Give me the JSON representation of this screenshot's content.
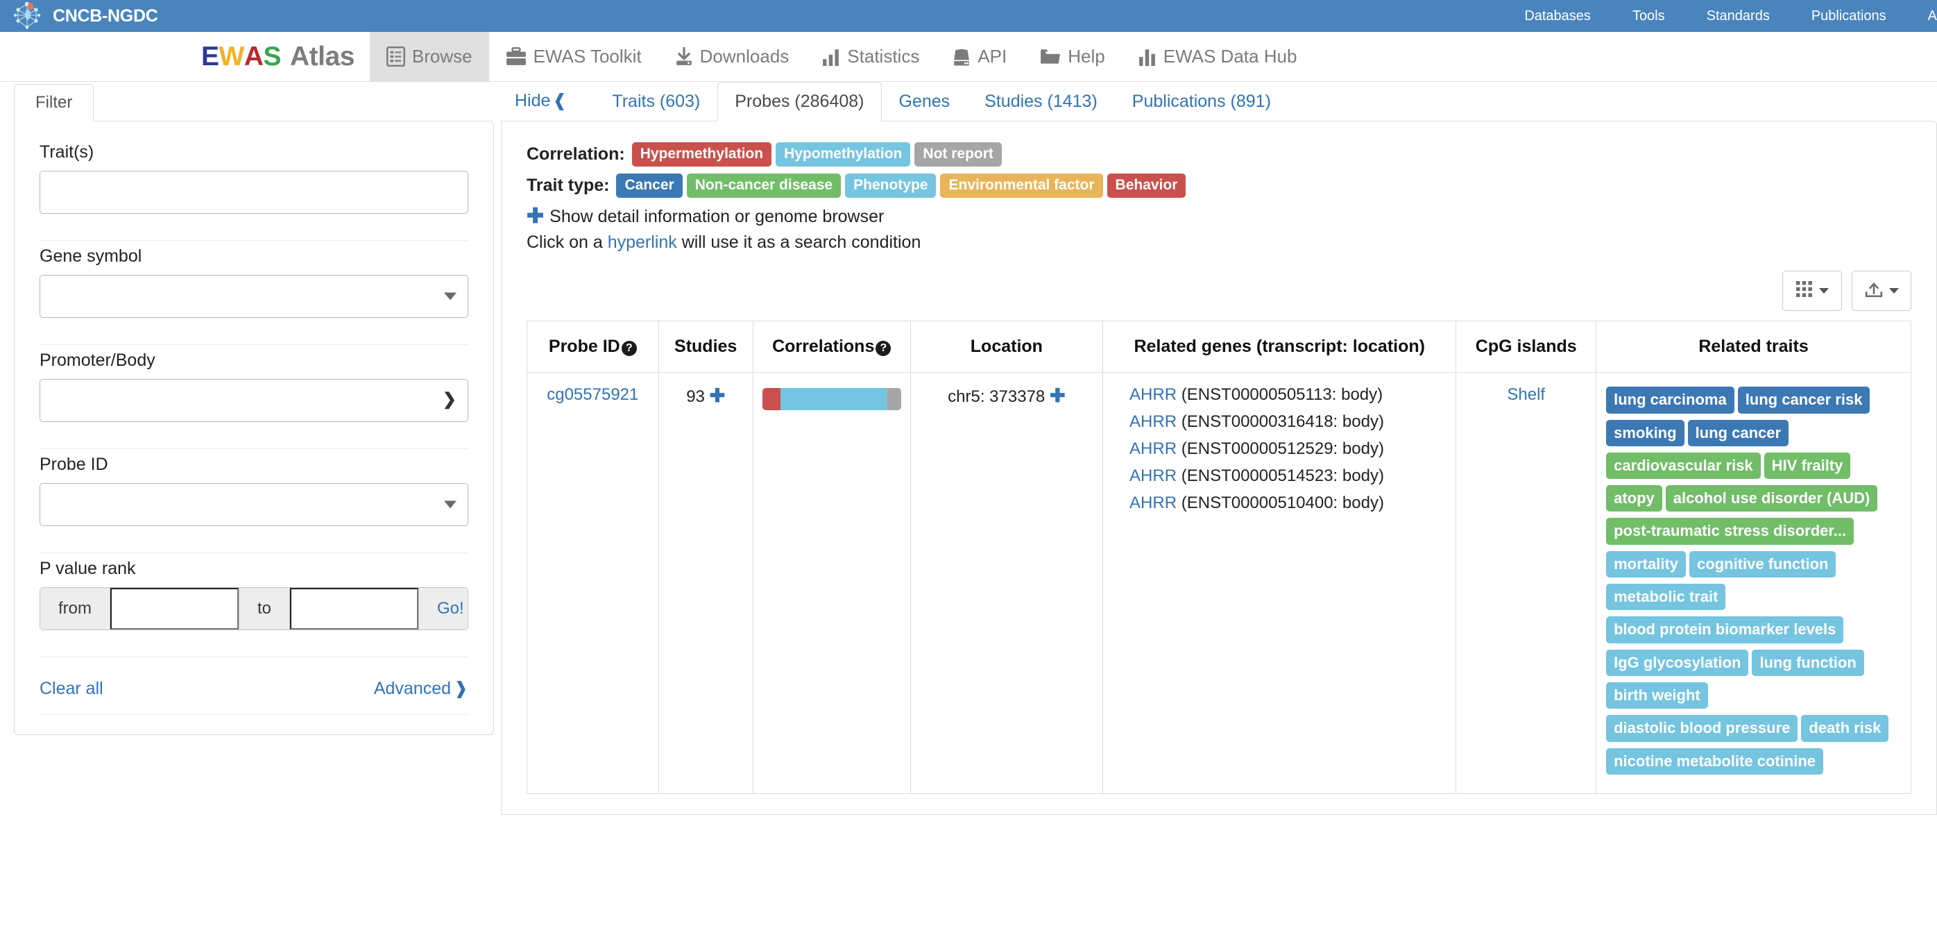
{
  "topbar": {
    "brand": "CNCB-NGDC",
    "logo_icon": "network-molecule-icon",
    "nav": [
      {
        "label": "Databases"
      },
      {
        "label": "Tools"
      },
      {
        "label": "Standards"
      },
      {
        "label": "Publications"
      },
      {
        "label": "A"
      }
    ],
    "bg_color": "#4a84bd"
  },
  "appbar": {
    "logo": {
      "e": "E",
      "w": "W",
      "a": "A",
      "s": "S",
      "atlas": "Atlas",
      "colors": {
        "e": "#2b3a97",
        "w": "#f2b227",
        "a": "#b92a2c",
        "s": "#3aa64c",
        "atlas": "#7d7d7d"
      }
    },
    "items": [
      {
        "label": "Browse",
        "icon": "list-document-icon",
        "active": true
      },
      {
        "label": "EWAS Toolkit",
        "icon": "briefcase-icon",
        "active": false
      },
      {
        "label": "Downloads",
        "icon": "download-icon",
        "active": false
      },
      {
        "label": "Statistics",
        "icon": "bar-chart-icon",
        "active": false
      },
      {
        "label": "API",
        "icon": "server-icon",
        "active": false
      },
      {
        "label": "Help",
        "icon": "folder-icon",
        "active": false
      },
      {
        "label": "EWAS Data Hub",
        "icon": "bar-chart-icon",
        "active": false
      }
    ]
  },
  "sidebar": {
    "tab_label": "Filter",
    "fields": {
      "traits_label": "Trait(s)",
      "traits_value": "",
      "gene_symbol_label": "Gene symbol",
      "gene_symbol_value": "",
      "promoter_body_label": "Promoter/Body",
      "promoter_body_value": "",
      "probe_id_label": "Probe ID",
      "probe_id_value": "",
      "p_value_rank_label": "P value rank",
      "from_label": "from",
      "from_value": "",
      "to_label": "to",
      "to_value": "",
      "go_label": "Go!"
    },
    "clear_all": "Clear all",
    "advanced": "Advanced"
  },
  "tabs": {
    "hide_label": "Hide",
    "items": [
      {
        "label": "Traits (603)",
        "active": false
      },
      {
        "label": "Probes (286408)",
        "active": true
      },
      {
        "label": "Genes",
        "active": false
      },
      {
        "label": "Studies (1413)",
        "active": false
      },
      {
        "label": "Publications (891)",
        "active": false
      }
    ]
  },
  "legend": {
    "correlation_label": "Correlation:",
    "correlation_items": [
      {
        "label": "Hypermethylation",
        "color": "#c9504c"
      },
      {
        "label": "Hypomethylation",
        "color": "#75c4e0"
      },
      {
        "label": "Not report",
        "color": "#a6a6a6"
      }
    ],
    "trait_type_label": "Trait type:",
    "trait_type_items": [
      {
        "label": "Cancer",
        "color": "#3c78b4"
      },
      {
        "label": "Non-cancer disease",
        "color": "#71bd68"
      },
      {
        "label": "Phenotype",
        "color": "#75c4e0"
      },
      {
        "label": "Environmental factor",
        "color": "#e9b45a"
      },
      {
        "label": "Behavior",
        "color": "#c9504c"
      }
    ],
    "detail_note": "Show detail information or genome browser",
    "hyperlink_note_pre": "Click on a ",
    "hyperlink_note_link": "hyperlink",
    "hyperlink_note_post": " will use it as a search condition"
  },
  "toolbar": {
    "columns_button_icon": "grid-icon",
    "export_button_icon": "export-icon"
  },
  "table": {
    "headers": [
      {
        "label": "Probe ID",
        "help": true
      },
      {
        "label": "Studies",
        "help": false
      },
      {
        "label": "Correlations",
        "help": true
      },
      {
        "label": "Location",
        "help": false
      },
      {
        "label": "Related genes (transcript: location)",
        "help": false
      },
      {
        "label": "CpG islands",
        "help": false
      },
      {
        "label": "Related traits",
        "help": false
      }
    ],
    "rows": [
      {
        "probe_id": "cg05575921",
        "studies": "93",
        "correlations": [
          {
            "type": "Hypermethylation",
            "color": "#c9504c",
            "percent": 13
          },
          {
            "type": "Hypomethylation",
            "color": "#75c4e0",
            "percent": 77
          },
          {
            "type": "Not report",
            "color": "#a6a6a6",
            "percent": 10
          }
        ],
        "location": "chr5: 373378",
        "related_genes": [
          {
            "gene": "AHRR",
            "detail": "(ENST00000505113:  body)"
          },
          {
            "gene": "AHRR",
            "detail": "(ENST00000316418:  body)"
          },
          {
            "gene": "AHRR",
            "detail": "(ENST00000512529:  body)"
          },
          {
            "gene": "AHRR",
            "detail": "(ENST00000514523:  body)"
          },
          {
            "gene": "AHRR",
            "detail": "(ENST00000510400:  body)"
          }
        ],
        "cpg_islands": "Shelf",
        "related_traits": [
          {
            "label": "lung carcinoma",
            "type": "Cancer",
            "color": "#3c78b4"
          },
          {
            "label": "lung cancer risk",
            "type": "Cancer",
            "color": "#3c78b4"
          },
          {
            "label": "smoking",
            "type": "Cancer",
            "color": "#3c78b4"
          },
          {
            "label": "lung cancer",
            "type": "Cancer",
            "color": "#3c78b4"
          },
          {
            "label": "cardiovascular risk",
            "type": "Non-cancer disease",
            "color": "#71bd68"
          },
          {
            "label": "HIV frailty",
            "type": "Non-cancer disease",
            "color": "#71bd68"
          },
          {
            "label": "atopy",
            "type": "Non-cancer disease",
            "color": "#71bd68"
          },
          {
            "label": "alcohol use disorder (AUD)",
            "type": "Non-cancer disease",
            "color": "#71bd68"
          },
          {
            "label": "post-traumatic stress disorder...",
            "type": "Non-cancer disease",
            "color": "#71bd68"
          },
          {
            "label": "mortality",
            "type": "Phenotype",
            "color": "#75c4e0"
          },
          {
            "label": "cognitive function",
            "type": "Phenotype",
            "color": "#75c4e0"
          },
          {
            "label": "metabolic trait",
            "type": "Phenotype",
            "color": "#75c4e0"
          },
          {
            "label": "blood protein biomarker levels",
            "type": "Phenotype",
            "color": "#75c4e0"
          },
          {
            "label": "IgG glycosylation",
            "type": "Phenotype",
            "color": "#75c4e0"
          },
          {
            "label": "lung function",
            "type": "Phenotype",
            "color": "#75c4e0"
          },
          {
            "label": "birth weight",
            "type": "Phenotype",
            "color": "#75c4e0"
          },
          {
            "label": "diastolic blood pressure",
            "type": "Phenotype",
            "color": "#75c4e0"
          },
          {
            "label": "death risk",
            "type": "Phenotype",
            "color": "#75c4e0"
          },
          {
            "label": "nicotine metabolite cotinine",
            "type": "Phenotype",
            "color": "#75c4e0"
          }
        ]
      }
    ]
  }
}
